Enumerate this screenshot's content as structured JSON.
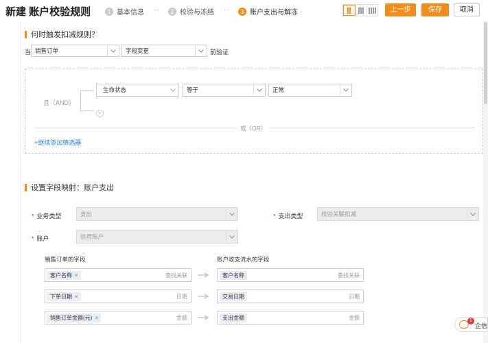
{
  "header": {
    "title": "新建 账户校验规则",
    "steps": [
      {
        "num": "1",
        "label": "基本信息"
      },
      {
        "num": "2",
        "label": "校验与冻结"
      },
      {
        "num": "3",
        "label": "账户支出与解冻"
      }
    ],
    "step_separator": "··",
    "active_step": 3,
    "prev_label": "上一步",
    "save_label": "保存",
    "cancel_label": "取消",
    "accent_color": "#f28c1b"
  },
  "trigger": {
    "title": "何时触发扣减规则？",
    "prefix": "当",
    "object_select": "销售订单",
    "event_select": "字段变更",
    "suffix": "前验证",
    "and_label": "且（AND）",
    "condition": {
      "field": "生命状态",
      "operator": "等于",
      "value": "正常"
    },
    "or_label": "或（OR）",
    "add_filter_label": "+继续添加筛选器"
  },
  "mapping": {
    "title": "设置字段映射：账户支出",
    "business_type_label": "业务类型",
    "business_type_value": "支出",
    "expense_type_label": "支出类型",
    "expense_type_value": "校验关联扣减",
    "account_label": "账户",
    "account_value": "信用账户",
    "left_header": "销售订单的字段",
    "right_header": "账户收支流水的字段",
    "rows": [
      {
        "left_tag": "客户名称",
        "left_hint": "查找关联",
        "right_tag": "客户名称",
        "right_hint": "查找关联"
      },
      {
        "left_tag": "下单日期",
        "left_hint": "日期",
        "right_tag": "交易日期",
        "right_hint": "日期"
      },
      {
        "left_tag": "销售订单金额(元)",
        "left_hint": "金额",
        "right_tag": "支出金额",
        "right_hint": "金额"
      }
    ],
    "remove_glyph": "×"
  },
  "chat": {
    "badge": "1",
    "label": "企信"
  }
}
